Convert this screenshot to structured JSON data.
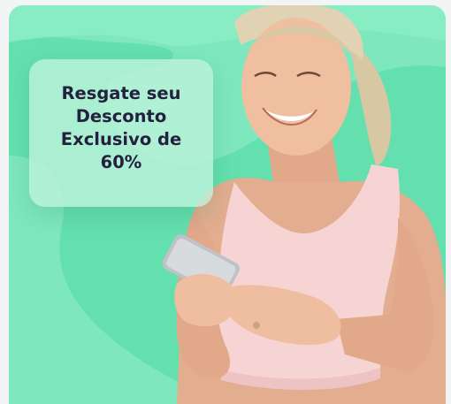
{
  "promo": {
    "headline": "Resgate seu Desconto Exclusivo de 60%"
  },
  "hero_image": {
    "subject": "smiling-woman-using-smartphone"
  },
  "colors": {
    "card_background": "#7ee7bd",
    "wave_shape": "#4fd8a3",
    "promo_card": "#bef4dd",
    "headline_text": "#23213d"
  }
}
